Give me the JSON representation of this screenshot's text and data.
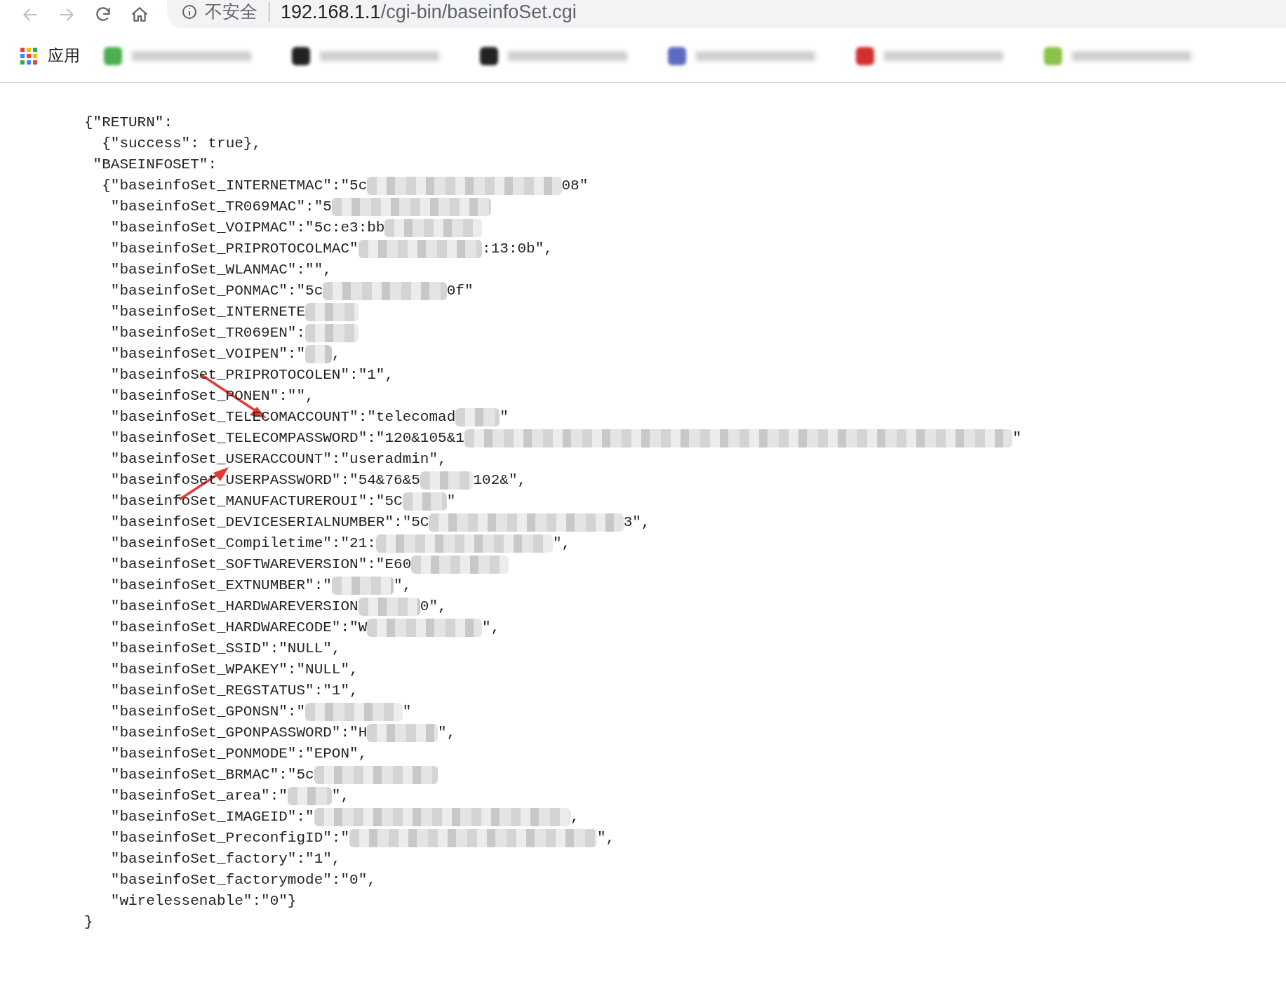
{
  "toolbar": {
    "security_label": "不安全",
    "url_host": "192.168.1.1",
    "url_path": "/cgi-bin/baseinfoSet.cgi"
  },
  "bookmarks": {
    "apps_label": "应用",
    "items": [
      {
        "color": "#4caf50"
      },
      {
        "color": "#222222"
      },
      {
        "color": "#222222"
      },
      {
        "color": "#5c6bc0"
      },
      {
        "color": "#d32f2f"
      },
      {
        "color": "#8bc34a"
      }
    ]
  },
  "lines": [
    {
      "text": "{\"RETURN\":"
    },
    {
      "text": "{\"success\": true},"
    },
    {
      "text": "\"BASEINFOSET\":"
    },
    {
      "text": "{\"baseinfoSet_INTERNETMAC\":\"5c",
      "redacted": true,
      "after": "08\""
    },
    {
      "text": "\"baseinfoSet_TR069MAC\":\"5",
      "redacted": true
    },
    {
      "text": "\"baseinfoSet_VOIPMAC\":\"5c:e3:bb",
      "redacted": true
    },
    {
      "text": "\"baseinfoSet_PRIPROTOCOLMAC\"",
      "redacted": true,
      "after": ":13:0b\","
    },
    {
      "text": "\"baseinfoSet_WLANMAC\":\"\","
    },
    {
      "text": "\"baseinfoSet_PONMAC\":\"5c",
      "redacted": true,
      "after": "0f\""
    },
    {
      "text": "\"baseinfoSet_INTERNETE",
      "redacted": true
    },
    {
      "text": "\"baseinfoSet_TR069EN\":",
      "redacted": true
    },
    {
      "text": "\"baseinfoSet_VOIPEN\":\"",
      "redacted": true,
      "after": ","
    },
    {
      "text": "\"baseinfoSet_PRIPROTOCOLEN\":\"1\","
    },
    {
      "text": "\"baseinfoSet_PONEN\":\"\","
    },
    {
      "text": "\"baseinfoSet_TELECOMACCOUNT\":\"telecomad",
      "redacted": true,
      "after": "\""
    },
    {
      "text": "\"baseinfoSet_TELECOMPASSWORD\":\"120&105&1",
      "redacted": true,
      "after": "\""
    },
    {
      "text": "\"baseinfoSet_USERACCOUNT\":\"useradmin\","
    },
    {
      "text": "\"baseinfoSet_USERPASSWORD\":\"54&76&5",
      "redacted": true,
      "after": "102&\","
    },
    {
      "text": "\"baseinfoSet_MANUFACTUREROUI\":\"5C",
      "redacted": true,
      "after": "\""
    },
    {
      "text": "\"baseinfoSet_DEVICESERIALNUMBER\":\"5C",
      "redacted": true,
      "after": "3\","
    },
    {
      "text": "\"baseinfoSet_Compiletime\":\"21:",
      "redacted": true,
      "after": "\","
    },
    {
      "text": "\"baseinfoSet_SOFTWAREVERSION\":\"E60",
      "redacted": true
    },
    {
      "text": "\"baseinfoSet_EXTNUMBER\":\"",
      "redacted": true,
      "after": "\","
    },
    {
      "text": "\"baseinfoSet_HARDWAREVERSION",
      "redacted": true,
      "after": "0\","
    },
    {
      "text": "\"baseinfoSet_HARDWARECODE\":\"W",
      "redacted": true,
      "after": "\","
    },
    {
      "text": "\"baseinfoSet_SSID\":\"NULL\","
    },
    {
      "text": "\"baseinfoSet_WPAKEY\":\"NULL\","
    },
    {
      "text": "\"baseinfoSet_REGSTATUS\":\"1\","
    },
    {
      "text": "\"baseinfoSet_GPONSN\":\"",
      "redacted": true,
      "after": "\""
    },
    {
      "text": "\"baseinfoSet_GPONPASSWORD\":\"H",
      "redacted": true,
      "after": "\","
    },
    {
      "text": "\"baseinfoSet_PONMODE\":\"EPON\","
    },
    {
      "text": "\"baseinfoSet_BRMAC\":\"5c",
      "redacted": true
    },
    {
      "text": "\"baseinfoSet_area\":\"",
      "redacted": true,
      "after": "\","
    },
    {
      "text": "\"baseinfoSet_IMAGEID\":\"",
      "redacted": true,
      "after": ","
    },
    {
      "text": "\"baseinfoSet_PreconfigID\":\"",
      "redacted": true,
      "after": "\","
    },
    {
      "text": "\"baseinfoSet_factory\":\"1\","
    },
    {
      "text": "\"baseinfoSet_factorymode\":\"0\","
    },
    {
      "text": "\"wirelessenable\":\"0\"}"
    },
    {
      "text": "}"
    }
  ]
}
